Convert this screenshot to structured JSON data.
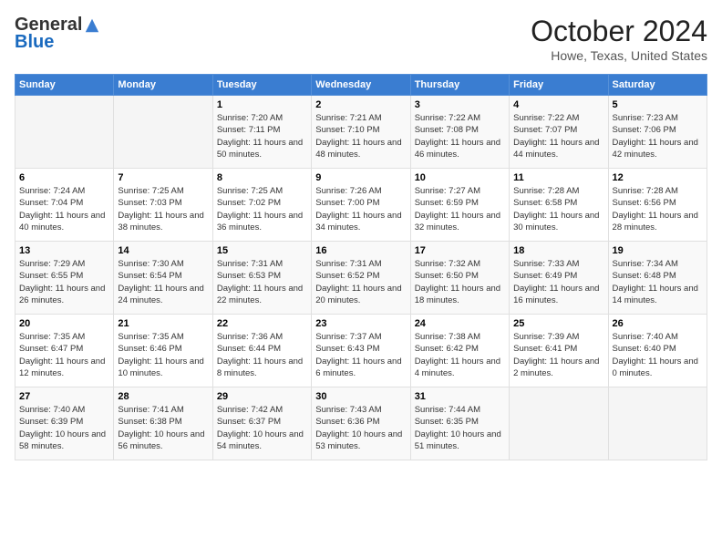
{
  "header": {
    "logo_general": "General",
    "logo_blue": "Blue",
    "month_title": "October 2024",
    "location": "Howe, Texas, United States"
  },
  "weekdays": [
    "Sunday",
    "Monday",
    "Tuesday",
    "Wednesday",
    "Thursday",
    "Friday",
    "Saturday"
  ],
  "weeks": [
    [
      {
        "day": null
      },
      {
        "day": null
      },
      {
        "day": "1",
        "sunrise": "Sunrise: 7:20 AM",
        "sunset": "Sunset: 7:11 PM",
        "daylight": "Daylight: 11 hours and 50 minutes."
      },
      {
        "day": "2",
        "sunrise": "Sunrise: 7:21 AM",
        "sunset": "Sunset: 7:10 PM",
        "daylight": "Daylight: 11 hours and 48 minutes."
      },
      {
        "day": "3",
        "sunrise": "Sunrise: 7:22 AM",
        "sunset": "Sunset: 7:08 PM",
        "daylight": "Daylight: 11 hours and 46 minutes."
      },
      {
        "day": "4",
        "sunrise": "Sunrise: 7:22 AM",
        "sunset": "Sunset: 7:07 PM",
        "daylight": "Daylight: 11 hours and 44 minutes."
      },
      {
        "day": "5",
        "sunrise": "Sunrise: 7:23 AM",
        "sunset": "Sunset: 7:06 PM",
        "daylight": "Daylight: 11 hours and 42 minutes."
      }
    ],
    [
      {
        "day": "6",
        "sunrise": "Sunrise: 7:24 AM",
        "sunset": "Sunset: 7:04 PM",
        "daylight": "Daylight: 11 hours and 40 minutes."
      },
      {
        "day": "7",
        "sunrise": "Sunrise: 7:25 AM",
        "sunset": "Sunset: 7:03 PM",
        "daylight": "Daylight: 11 hours and 38 minutes."
      },
      {
        "day": "8",
        "sunrise": "Sunrise: 7:25 AM",
        "sunset": "Sunset: 7:02 PM",
        "daylight": "Daylight: 11 hours and 36 minutes."
      },
      {
        "day": "9",
        "sunrise": "Sunrise: 7:26 AM",
        "sunset": "Sunset: 7:00 PM",
        "daylight": "Daylight: 11 hours and 34 minutes."
      },
      {
        "day": "10",
        "sunrise": "Sunrise: 7:27 AM",
        "sunset": "Sunset: 6:59 PM",
        "daylight": "Daylight: 11 hours and 32 minutes."
      },
      {
        "day": "11",
        "sunrise": "Sunrise: 7:28 AM",
        "sunset": "Sunset: 6:58 PM",
        "daylight": "Daylight: 11 hours and 30 minutes."
      },
      {
        "day": "12",
        "sunrise": "Sunrise: 7:28 AM",
        "sunset": "Sunset: 6:56 PM",
        "daylight": "Daylight: 11 hours and 28 minutes."
      }
    ],
    [
      {
        "day": "13",
        "sunrise": "Sunrise: 7:29 AM",
        "sunset": "Sunset: 6:55 PM",
        "daylight": "Daylight: 11 hours and 26 minutes."
      },
      {
        "day": "14",
        "sunrise": "Sunrise: 7:30 AM",
        "sunset": "Sunset: 6:54 PM",
        "daylight": "Daylight: 11 hours and 24 minutes."
      },
      {
        "day": "15",
        "sunrise": "Sunrise: 7:31 AM",
        "sunset": "Sunset: 6:53 PM",
        "daylight": "Daylight: 11 hours and 22 minutes."
      },
      {
        "day": "16",
        "sunrise": "Sunrise: 7:31 AM",
        "sunset": "Sunset: 6:52 PM",
        "daylight": "Daylight: 11 hours and 20 minutes."
      },
      {
        "day": "17",
        "sunrise": "Sunrise: 7:32 AM",
        "sunset": "Sunset: 6:50 PM",
        "daylight": "Daylight: 11 hours and 18 minutes."
      },
      {
        "day": "18",
        "sunrise": "Sunrise: 7:33 AM",
        "sunset": "Sunset: 6:49 PM",
        "daylight": "Daylight: 11 hours and 16 minutes."
      },
      {
        "day": "19",
        "sunrise": "Sunrise: 7:34 AM",
        "sunset": "Sunset: 6:48 PM",
        "daylight": "Daylight: 11 hours and 14 minutes."
      }
    ],
    [
      {
        "day": "20",
        "sunrise": "Sunrise: 7:35 AM",
        "sunset": "Sunset: 6:47 PM",
        "daylight": "Daylight: 11 hours and 12 minutes."
      },
      {
        "day": "21",
        "sunrise": "Sunrise: 7:35 AM",
        "sunset": "Sunset: 6:46 PM",
        "daylight": "Daylight: 11 hours and 10 minutes."
      },
      {
        "day": "22",
        "sunrise": "Sunrise: 7:36 AM",
        "sunset": "Sunset: 6:44 PM",
        "daylight": "Daylight: 11 hours and 8 minutes."
      },
      {
        "day": "23",
        "sunrise": "Sunrise: 7:37 AM",
        "sunset": "Sunset: 6:43 PM",
        "daylight": "Daylight: 11 hours and 6 minutes."
      },
      {
        "day": "24",
        "sunrise": "Sunrise: 7:38 AM",
        "sunset": "Sunset: 6:42 PM",
        "daylight": "Daylight: 11 hours and 4 minutes."
      },
      {
        "day": "25",
        "sunrise": "Sunrise: 7:39 AM",
        "sunset": "Sunset: 6:41 PM",
        "daylight": "Daylight: 11 hours and 2 minutes."
      },
      {
        "day": "26",
        "sunrise": "Sunrise: 7:40 AM",
        "sunset": "Sunset: 6:40 PM",
        "daylight": "Daylight: 11 hours and 0 minutes."
      }
    ],
    [
      {
        "day": "27",
        "sunrise": "Sunrise: 7:40 AM",
        "sunset": "Sunset: 6:39 PM",
        "daylight": "Daylight: 10 hours and 58 minutes."
      },
      {
        "day": "28",
        "sunrise": "Sunrise: 7:41 AM",
        "sunset": "Sunset: 6:38 PM",
        "daylight": "Daylight: 10 hours and 56 minutes."
      },
      {
        "day": "29",
        "sunrise": "Sunrise: 7:42 AM",
        "sunset": "Sunset: 6:37 PM",
        "daylight": "Daylight: 10 hours and 54 minutes."
      },
      {
        "day": "30",
        "sunrise": "Sunrise: 7:43 AM",
        "sunset": "Sunset: 6:36 PM",
        "daylight": "Daylight: 10 hours and 53 minutes."
      },
      {
        "day": "31",
        "sunrise": "Sunrise: 7:44 AM",
        "sunset": "Sunset: 6:35 PM",
        "daylight": "Daylight: 10 hours and 51 minutes."
      },
      {
        "day": null
      },
      {
        "day": null
      }
    ]
  ]
}
